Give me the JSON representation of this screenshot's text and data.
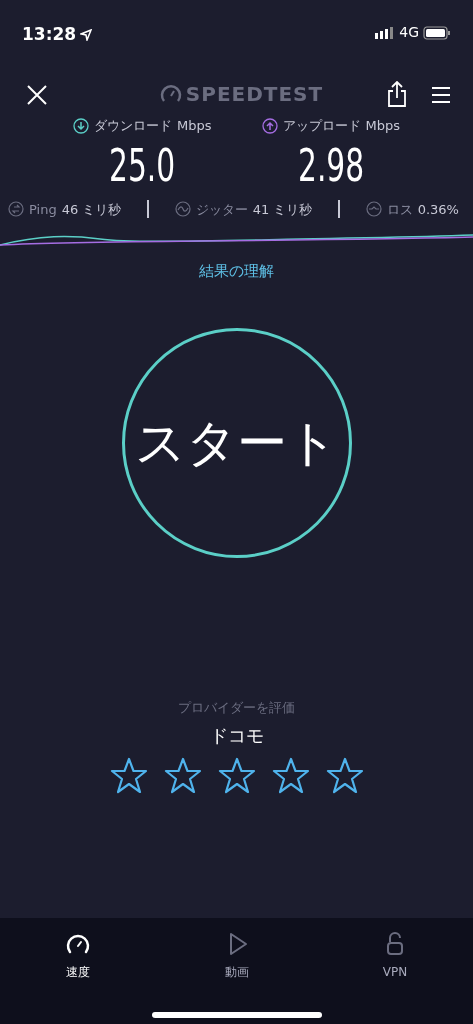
{
  "status_bar": {
    "time": "13:28",
    "network": "4G"
  },
  "header": {
    "logo": "SPEEDTEST"
  },
  "results": [
    {
      "kind": "download",
      "label": "ダウンロード",
      "unit": "Mbps",
      "value": "25.0"
    },
    {
      "kind": "upload",
      "label": "アップロード",
      "unit": "Mbps",
      "value": "2.98"
    }
  ],
  "metrics": [
    {
      "kind": "ping",
      "label": "Ping",
      "value": "46",
      "unit": "ミリ秒"
    },
    {
      "kind": "jitter",
      "label": "ジッター",
      "value": "41",
      "unit": "ミリ秒"
    },
    {
      "kind": "loss",
      "label": "ロス",
      "value": "0.36%"
    }
  ],
  "results_link": "結果の理解",
  "start_button": "スタート",
  "rating": {
    "prompt": "プロバイダーを評価",
    "provider": "ドコモ",
    "stars": 0
  },
  "tabs": [
    {
      "kind": "speed",
      "label": "速度",
      "selected": true
    },
    {
      "kind": "video",
      "label": "動画",
      "selected": false
    },
    {
      "kind": "vpn",
      "label": "VPN",
      "selected": false
    }
  ]
}
